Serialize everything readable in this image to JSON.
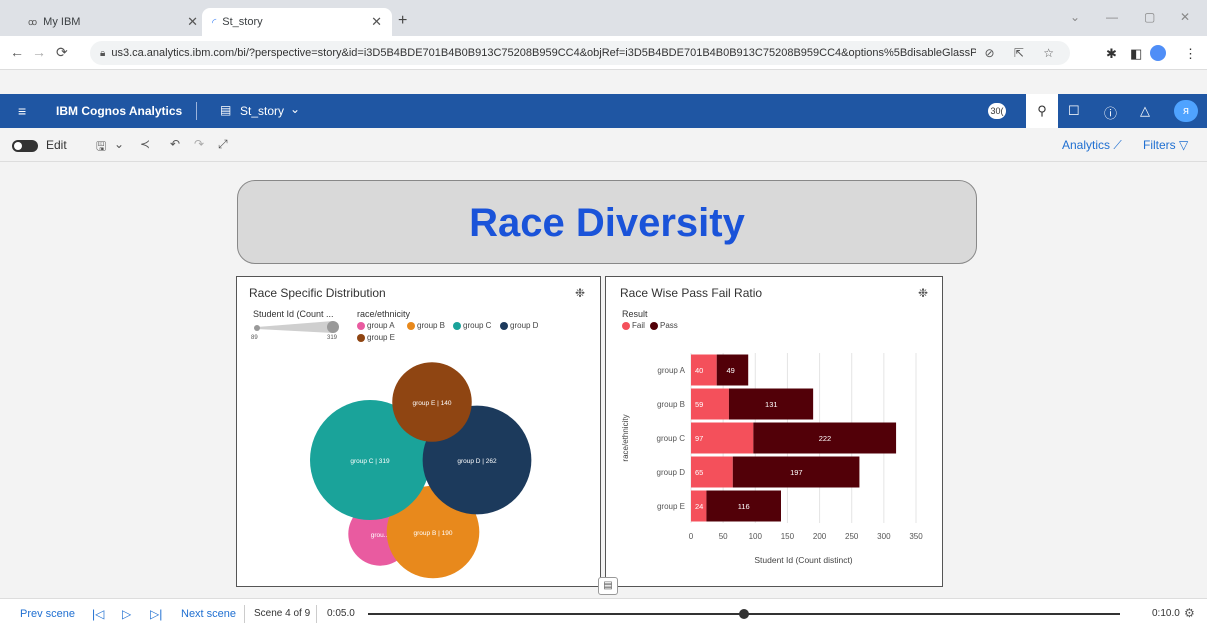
{
  "browser": {
    "tabs": [
      {
        "label": "My IBM",
        "icon": "ibm-icon",
        "active": false
      },
      {
        "label": "St_story",
        "icon": "loading-icon",
        "active": true
      }
    ],
    "url": "us3.ca.analytics.ibm.com/bi/?perspective=story&id=i3D5B4BDE701B4B0B913C75208B959CC4&objRef=i3D5B4BDE701B4B0B913C75208B959CC4&options%5BdisableGlassPrefetch%5D=..."
  },
  "appbar": {
    "brand": "IBM Cognos Analytics",
    "story_title": "St_story",
    "notification_count": "30("
  },
  "toolbar": {
    "edit_label": "Edit",
    "analytics_label": "Analytics",
    "filters_label": "Filters"
  },
  "story": {
    "title": "Race Diversity"
  },
  "bubble_panel": {
    "title": "Race Specific Distribution",
    "size_legend_title": "Student Id (Count ...",
    "size_min": "89",
    "size_max": "319",
    "color_legend_title": "race/ethnicity",
    "groups": [
      {
        "name": "group A",
        "label": "grou...",
        "value": 89,
        "color": "#e95ba0"
      },
      {
        "name": "group B",
        "label": "group B | 190",
        "value": 190,
        "color": "#e8891c"
      },
      {
        "name": "group C",
        "label": "group C | 319",
        "value": 319,
        "color": "#1aa39a"
      },
      {
        "name": "group D",
        "label": "group D | 262",
        "value": 262,
        "color": "#1c3a5c"
      },
      {
        "name": "group E",
        "label": "group E | 140",
        "value": 140,
        "color": "#8f4512"
      }
    ]
  },
  "bar_panel": {
    "title": "Race Wise Pass Fail Ratio",
    "legend_title": "Result",
    "legend": [
      {
        "name": "Fail",
        "color": "#f4505b"
      },
      {
        "name": "Pass",
        "color": "#520008"
      }
    ]
  },
  "chart_data": {
    "type": "bar",
    "orientation": "horizontal",
    "stacked": true,
    "categories": [
      "group A",
      "group B",
      "group C",
      "group D",
      "group E"
    ],
    "series": [
      {
        "name": "Fail",
        "values": [
          40,
          59,
          97,
          65,
          24
        ],
        "color": "#f4505b"
      },
      {
        "name": "Pass",
        "values": [
          49,
          131,
          222,
          197,
          116
        ],
        "color": "#520008"
      }
    ],
    "xlabel": "Student Id (Count distinct)",
    "ylabel": "race/ethnicity",
    "xlim": [
      0,
      350
    ],
    "xticks": [
      0,
      50,
      100,
      150,
      200,
      250,
      300,
      350
    ],
    "grid": true,
    "legend_position": "top-left"
  },
  "footer": {
    "prev_label": "Prev scene",
    "next_label": "Next scene",
    "scene_label": "Scene 4 of 9",
    "time_start": "0:05.0",
    "time_end": "0:10.0",
    "progress": 0.5
  }
}
